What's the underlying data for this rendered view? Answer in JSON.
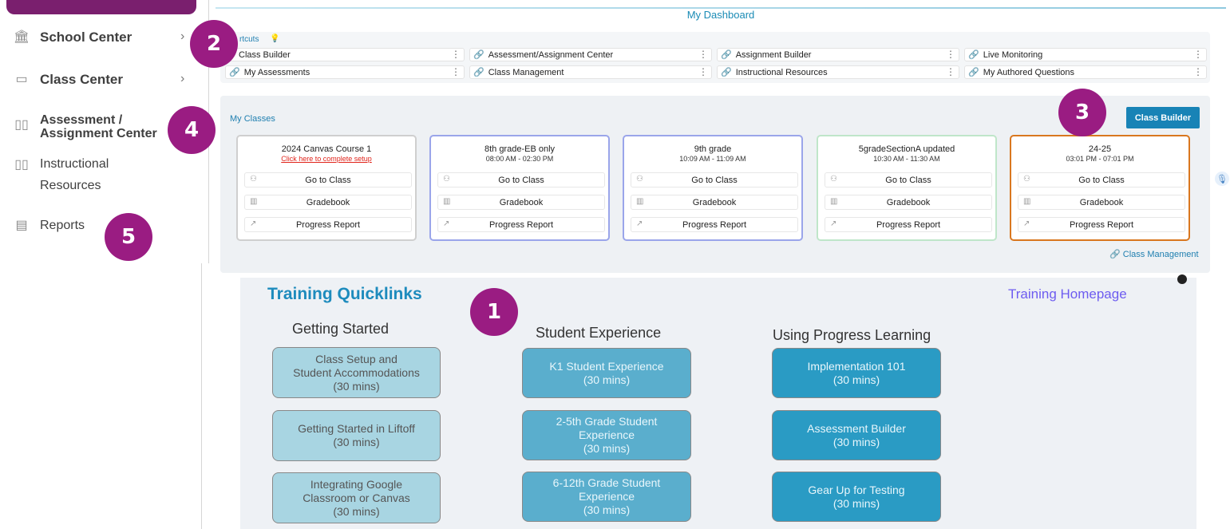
{
  "sidebar": {
    "items": [
      {
        "label": "School Center",
        "icon": "school-icon"
      },
      {
        "label": "Class Center",
        "icon": "class-icon"
      },
      {
        "label": "Assessment /\nAssignment Center",
        "icon": "book-icon"
      },
      {
        "label": "Instructional\nResources",
        "icon": "book-open-icon"
      },
      {
        "label": "Reports",
        "icon": "report-icon"
      }
    ]
  },
  "badges": [
    "1",
    "2",
    "3",
    "4",
    "5"
  ],
  "dashboard": {
    "title": "My Dashboard"
  },
  "shortcuts": {
    "label": "rtcuts",
    "items": [
      "Class Builder",
      "Assessment/Assignment Center",
      "Assignment Builder",
      "Live Monitoring",
      "My Assessments",
      "Class Management",
      "Instructional Resources",
      "My Authored Questions"
    ]
  },
  "classes": {
    "label": "My Classes",
    "builder_button": "Class Builder",
    "management_link": "Class Management",
    "cards": [
      {
        "title": "2024 Canvas Course 1",
        "sub": "Click here to complete setup",
        "border": "#cfcfcf"
      },
      {
        "title": "8th grade-EB only",
        "sub": "08:00 AM - 02:30 PM",
        "border": "#9aa5ea"
      },
      {
        "title": "9th grade",
        "sub": "10:09 AM - 11:09 AM",
        "border": "#9aa5ea"
      },
      {
        "title": "5gradeSectionA updated",
        "sub": "10:30 AM - 11:30 AM",
        "border": "#bfe6c9"
      },
      {
        "title": "24-25",
        "sub": "03:01 PM - 07:01 PM",
        "border": "#d9771f"
      }
    ],
    "actions": [
      "Go to Class",
      "Gradebook",
      "Progress Report"
    ]
  },
  "training": {
    "title": "Training Quicklinks",
    "homepage": "Training Homepage",
    "columns": [
      {
        "heading": "Getting Started",
        "buttons": [
          "Class Setup and\nStudent Accommodations\n(30 mins)",
          "Getting Started in Liftoff\n(30 mins)",
          "Integrating Google\nClassroom or Canvas\n(30 mins)"
        ]
      },
      {
        "heading": "Student Experience",
        "buttons": [
          "K1 Student Experience\n(30 mins)",
          "2-5th Grade Student\nExperience\n(30 mins)",
          "6-12th Grade Student\nExperience\n(30 mins)"
        ]
      },
      {
        "heading": "Using Progress Learning",
        "buttons": [
          "Implementation 101\n(30 mins)",
          "Assessment Builder\n(30 mins)",
          "Gear Up for Testing\n(30 mins)"
        ]
      }
    ]
  },
  "colors": {
    "badge": "#9a1c82",
    "accent": "#1883b6",
    "sidebar_top": "#7a1f6e"
  }
}
